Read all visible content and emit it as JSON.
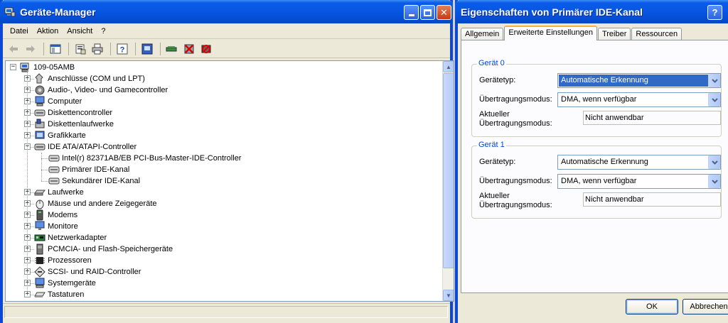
{
  "device_manager": {
    "title": "Geräte-Manager",
    "menu": [
      "Datei",
      "Aktion",
      "Ansicht",
      "?"
    ],
    "toolbar_icons": [
      "back-icon",
      "forward-icon",
      "console-tree-icon",
      "properties-icon",
      "print-icon",
      "help-icon",
      "show-hidden-icon",
      "scan-hardware-icon",
      "uninstall-icon",
      "disable-icon"
    ],
    "tree": {
      "root": "109-05AMB",
      "categories": [
        {
          "label": "Anschlüsse (COM und LPT)",
          "icon": "port-icon"
        },
        {
          "label": "Audio-, Video- und Gamecontroller",
          "icon": "audio-icon"
        },
        {
          "label": "Computer",
          "icon": "computer-icon"
        },
        {
          "label": "Diskettencontroller",
          "icon": "disk-controller-icon"
        },
        {
          "label": "Diskettenlaufwerke",
          "icon": "floppy-icon"
        },
        {
          "label": "Grafikkarte",
          "icon": "display-adapter-icon"
        },
        {
          "label": "IDE ATA/ATAPI-Controller",
          "icon": "ide-controller-icon",
          "expanded": true,
          "children": [
            "Intel(r) 82371AB/EB PCI-Bus-Master-IDE-Controller",
            "Primärer IDE-Kanal",
            "Sekundärer IDE-Kanal"
          ]
        },
        {
          "label": "Laufwerke",
          "icon": "drive-icon"
        },
        {
          "label": "Mäuse und andere Zeigegeräte",
          "icon": "mouse-icon"
        },
        {
          "label": "Modems",
          "icon": "modem-icon"
        },
        {
          "label": "Monitore",
          "icon": "monitor-icon"
        },
        {
          "label": "Netzwerkadapter",
          "icon": "network-adapter-icon"
        },
        {
          "label": "PCMCIA- und Flash-Speichergeräte",
          "icon": "pcmcia-icon"
        },
        {
          "label": "Prozessoren",
          "icon": "processor-icon"
        },
        {
          "label": "SCSI- und RAID-Controller",
          "icon": "scsi-icon"
        },
        {
          "label": "Systemgeräte",
          "icon": "system-device-icon"
        },
        {
          "label": "Tastaturen",
          "icon": "keyboard-icon"
        }
      ]
    }
  },
  "dialog": {
    "title": "Eigenschaften von Primärer IDE-Kanal",
    "tabs": [
      "Allgemein",
      "Erweiterte Einstellungen",
      "Treiber",
      "Ressourcen"
    ],
    "active_tab": "Erweiterte Einstellungen",
    "groups": [
      {
        "title": "Gerät 0",
        "device_type_label": "Gerätetyp:",
        "device_type_value": "Automatische Erkennung",
        "transfer_mode_label": "Übertragungsmodus:",
        "transfer_mode_value": "DMA, wenn verfügbar",
        "current_mode_label_1": "Aktueller",
        "current_mode_label_2": "Übertragungsmodus:",
        "current_mode_value": "Nicht anwendbar"
      },
      {
        "title": "Gerät 1",
        "device_type_label": "Gerätetyp:",
        "device_type_value": "Automatische Erkennung",
        "transfer_mode_label": "Übertragungsmodus:",
        "transfer_mode_value": "DMA, wenn verfügbar",
        "current_mode_label_1": "Aktueller",
        "current_mode_label_2": "Übertragungsmodus:",
        "current_mode_value": "Nicht anwendbar"
      }
    ],
    "ok_label": "OK",
    "cancel_label": "Abbrechen"
  },
  "colors": {
    "titlebar_blue": "#0655e1",
    "selection_blue": "#316ac5",
    "group_title_blue": "#0046d5",
    "window_face": "#ece9d8"
  }
}
